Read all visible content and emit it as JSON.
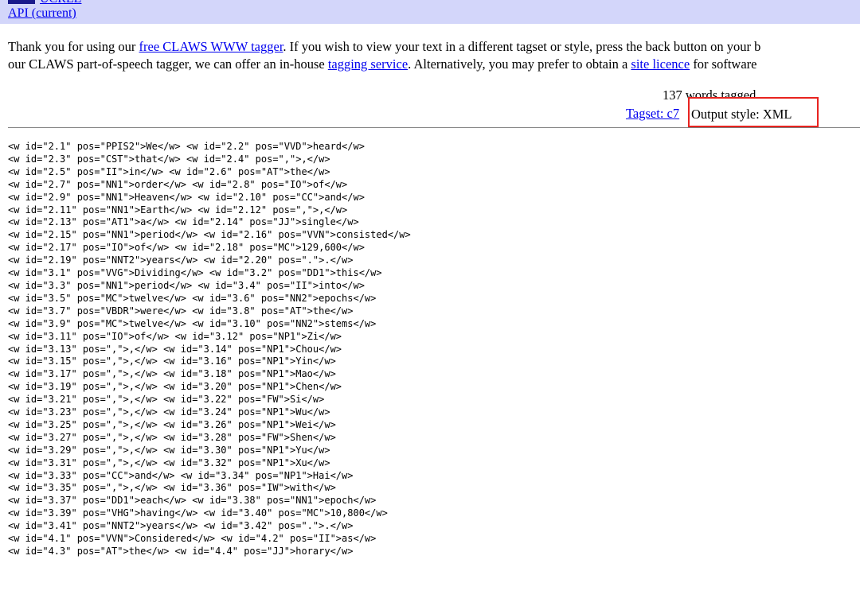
{
  "header": {
    "ucrel_link": "UCREL",
    "api_link": "API (current)"
  },
  "intro": {
    "line1_pre": "Thank you for using our ",
    "line1_link": "free CLAWS WWW tagger",
    "line1_post": ". If you wish to view your text in a different tagset or style, press the back button on your b",
    "line2_pre": "our CLAWS part-of-speech tagger, we can offer an in-house ",
    "line2_link1": "tagging service",
    "line2_mid": ". Alternatively, you may prefer to obtain a ",
    "line2_link2": "site licence",
    "line2_post": " for software"
  },
  "summary": {
    "words_tagged": "137 words tagged",
    "tagset_link": "Tagset: c7",
    "output_style": "Output style: XML"
  },
  "output_lines": [
    "<w id=\"2.1\" pos=\"PPIS2\">We</w> <w id=\"2.2\" pos=\"VVD\">heard</w>",
    "<w id=\"2.3\" pos=\"CST\">that</w> <w id=\"2.4\" pos=\",\">,</w>",
    "<w id=\"2.5\" pos=\"II\">in</w> <w id=\"2.6\" pos=\"AT\">the</w>",
    "<w id=\"2.7\" pos=\"NN1\">order</w> <w id=\"2.8\" pos=\"IO\">of</w>",
    "<w id=\"2.9\" pos=\"NN1\">Heaven</w> <w id=\"2.10\" pos=\"CC\">and</w>",
    "<w id=\"2.11\" pos=\"NN1\">Earth</w> <w id=\"2.12\" pos=\",\">,</w>",
    "<w id=\"2.13\" pos=\"AT1\">a</w> <w id=\"2.14\" pos=\"JJ\">single</w>",
    "<w id=\"2.15\" pos=\"NN1\">period</w> <w id=\"2.16\" pos=\"VVN\">consisted</w>",
    "<w id=\"2.17\" pos=\"IO\">of</w> <w id=\"2.18\" pos=\"MC\">129,600</w>",
    "<w id=\"2.19\" pos=\"NNT2\">years</w> <w id=\"2.20\" pos=\".\">.</w>",
    "<w id=\"3.1\" pos=\"VVG\">Dividing</w> <w id=\"3.2\" pos=\"DD1\">this</w>",
    "<w id=\"3.3\" pos=\"NN1\">period</w> <w id=\"3.4\" pos=\"II\">into</w>",
    "<w id=\"3.5\" pos=\"MC\">twelve</w> <w id=\"3.6\" pos=\"NN2\">epochs</w>",
    "<w id=\"3.7\" pos=\"VBDR\">were</w> <w id=\"3.8\" pos=\"AT\">the</w>",
    "<w id=\"3.9\" pos=\"MC\">twelve</w> <w id=\"3.10\" pos=\"NN2\">stems</w>",
    "<w id=\"3.11\" pos=\"IO\">of</w> <w id=\"3.12\" pos=\"NP1\">Zi</w>",
    "<w id=\"3.13\" pos=\",\">,</w> <w id=\"3.14\" pos=\"NP1\">Chou</w>",
    "<w id=\"3.15\" pos=\",\">,</w> <w id=\"3.16\" pos=\"NP1\">Yin</w>",
    "<w id=\"3.17\" pos=\",\">,</w> <w id=\"3.18\" pos=\"NP1\">Mao</w>",
    "<w id=\"3.19\" pos=\",\">,</w> <w id=\"3.20\" pos=\"NP1\">Chen</w>",
    "<w id=\"3.21\" pos=\",\">,</w> <w id=\"3.22\" pos=\"FW\">Si</w>",
    "<w id=\"3.23\" pos=\",\">,</w> <w id=\"3.24\" pos=\"NP1\">Wu</w>",
    "<w id=\"3.25\" pos=\",\">,</w> <w id=\"3.26\" pos=\"NP1\">Wei</w>",
    "<w id=\"3.27\" pos=\",\">,</w> <w id=\"3.28\" pos=\"FW\">Shen</w>",
    "<w id=\"3.29\" pos=\",\">,</w> <w id=\"3.30\" pos=\"NP1\">Yu</w>",
    "<w id=\"3.31\" pos=\",\">,</w> <w id=\"3.32\" pos=\"NP1\">Xu</w>",
    "<w id=\"3.33\" pos=\"CC\">and</w> <w id=\"3.34\" pos=\"NP1\">Hai</w>",
    "<w id=\"3.35\" pos=\",\">,</w> <w id=\"3.36\" pos=\"IW\">with</w>",
    "<w id=\"3.37\" pos=\"DD1\">each</w> <w id=\"3.38\" pos=\"NN1\">epoch</w>",
    "<w id=\"3.39\" pos=\"VHG\">having</w> <w id=\"3.40\" pos=\"MC\">10,800</w>",
    "<w id=\"3.41\" pos=\"NNT2\">years</w> <w id=\"3.42\" pos=\".\">.</w>",
    "<w id=\"4.1\" pos=\"VVN\">Considered</w> <w id=\"4.2\" pos=\"II\">as</w>",
    "<w id=\"4.3\" pos=\"AT\">the</w> <w id=\"4.4\" pos=\"JJ\">horary</w>"
  ]
}
